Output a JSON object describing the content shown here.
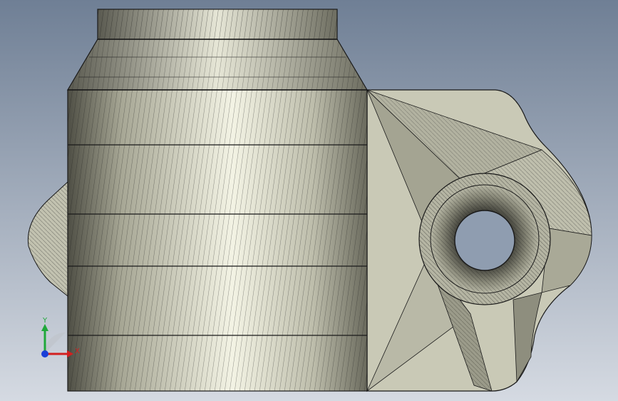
{
  "viewport": {
    "background_top": "#6f7f95",
    "background_bottom": "#d5dae2",
    "model_fill": "#c9c9b6",
    "model_light": "#eeeedd",
    "model_dark": "#7a7a6c",
    "edge_color": "#1a1a1a"
  },
  "triad": {
    "x_label": "X",
    "y_label": "Y",
    "x_color": "#d22020",
    "y_color": "#1fa83a",
    "z_color": "#1a3fd8"
  }
}
